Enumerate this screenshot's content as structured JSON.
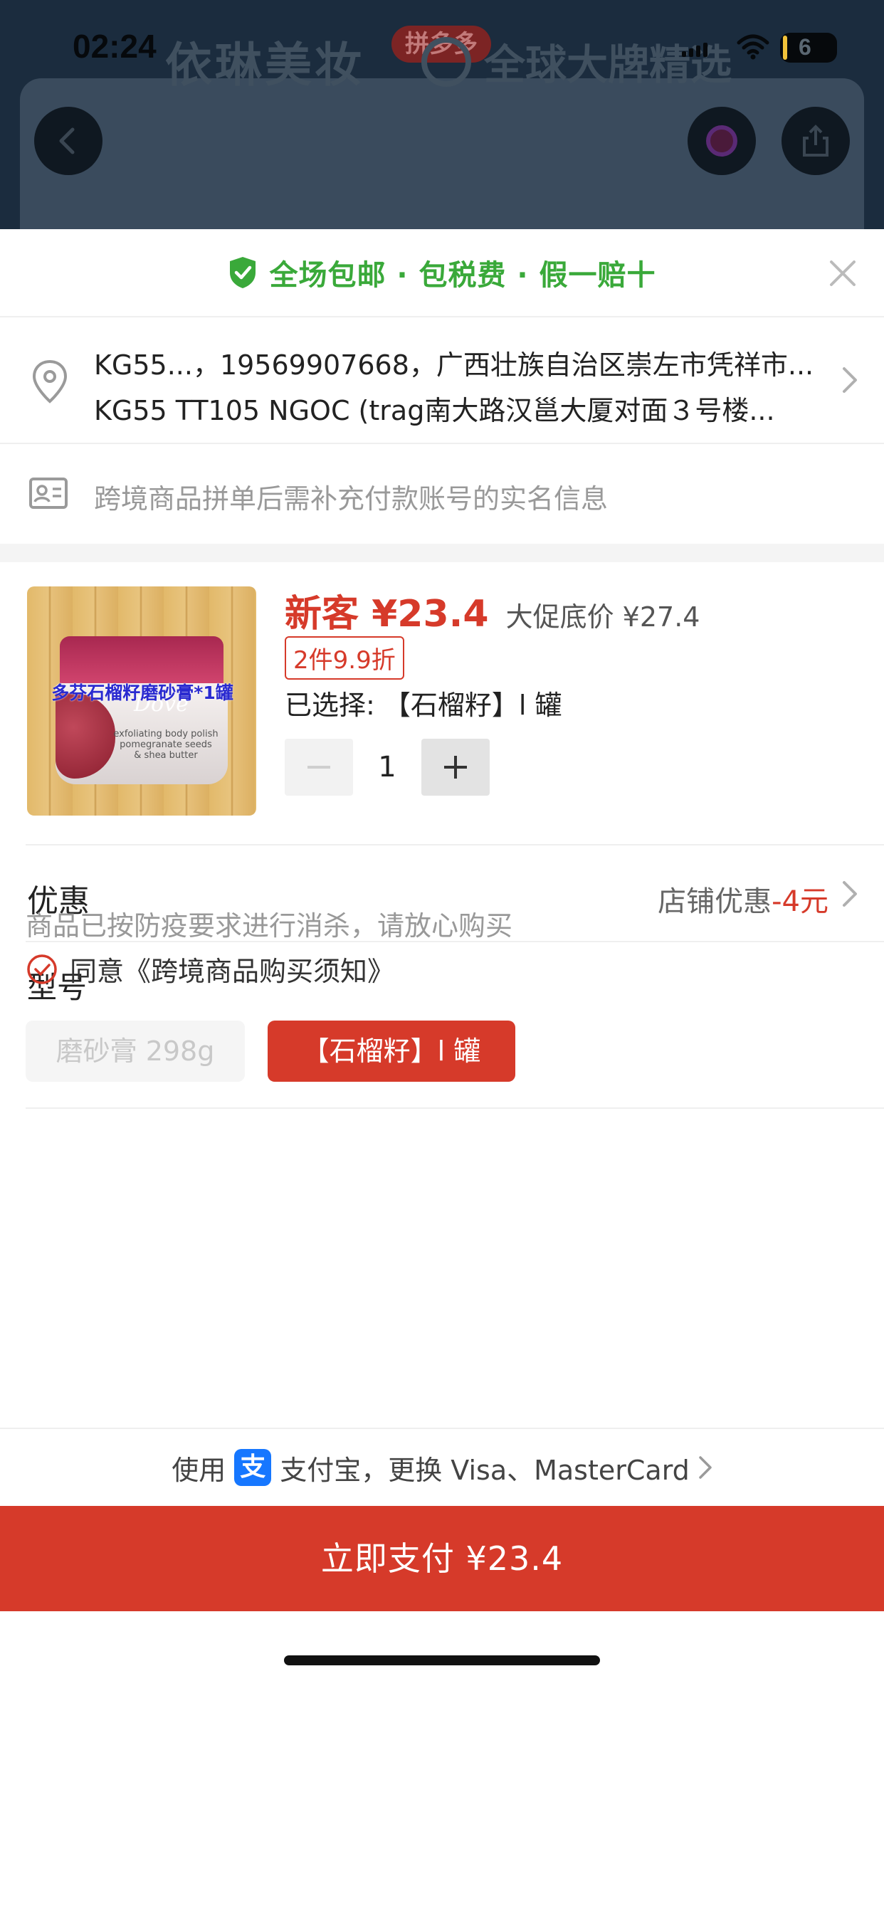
{
  "status_bar": {
    "time": "02:24",
    "battery": "6"
  },
  "background_page": {
    "store_name": "依琳美妆",
    "platform_badge": "拼多多",
    "tagline": "全球大牌精选"
  },
  "sheet": {
    "banner": "全场包邮 · 包税费 · 假一赔十",
    "address": {
      "line1": "KG55...，19569907668，广西壮族自治区崇左市凭祥市...",
      "line2": "KG55 TT105 NGOC (trag南大路汉邕大厦对面３号楼..."
    },
    "realname_hint": "跨境商品拼单后需补充付款账号的实名信息",
    "product": {
      "image_caption": "多芬石榴籽磨砂膏*1罐",
      "image_brand": "Dove",
      "image_desc": "exfoliating body polish\npomegranate seeds\n& shea butter",
      "new_price": "新客 ¥23.4",
      "promo_price": "大促底价 ¥27.4",
      "discount_tag": "2件9.9折",
      "selected": "已选择: 【石榴籽】l 罐",
      "quantity": "1"
    },
    "coupon": {
      "label": "优惠",
      "value_prefix": "店铺优惠",
      "value_amount": "-4元"
    },
    "model": {
      "label": "型号",
      "options": [
        "磨砂膏 298g",
        "【石榴籽】l 罐"
      ],
      "selected_index": 1
    },
    "notice": "商品已按防疫要求进行消杀，请放心购买",
    "agreement": "同意《跨境商品购买须知》",
    "payment": {
      "prefix": "使用",
      "alipay_glyph": "支",
      "text": "支付宝，更换 Visa、MasterCard"
    },
    "pay_button": "立即支付 ¥23.4"
  },
  "colors": {
    "accent_red": "#d63a2a",
    "banner_green": "#3aa93a",
    "alipay_blue": "#1677ff"
  }
}
